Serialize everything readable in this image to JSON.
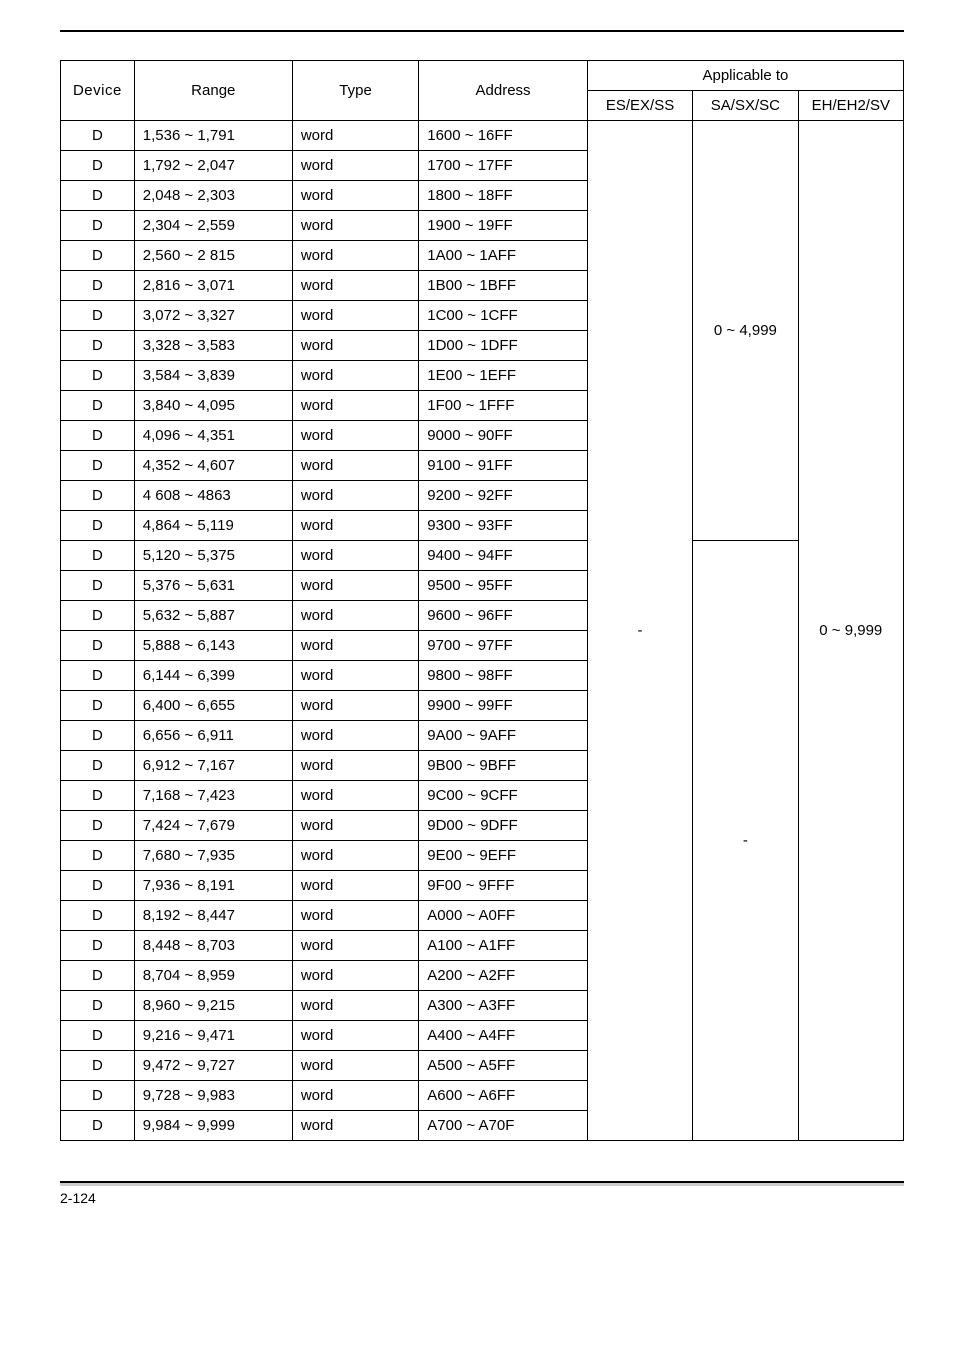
{
  "headers": {
    "device": "Device",
    "range": "Range",
    "type": "Type",
    "address": "Address",
    "applicable_to": "Applicable to",
    "es": "ES/EX/SS",
    "sa": "SA/SX/SC",
    "eh": "EH/EH2/SV"
  },
  "merged": {
    "es": "-",
    "sa1": "0 ~ 4,999",
    "sa2": "-",
    "eh": "0 ~ 9,999"
  },
  "rows": [
    {
      "device": "D",
      "range": "1,536 ~ 1,791",
      "type": "word",
      "address": "1600 ~ 16FF"
    },
    {
      "device": "D",
      "range": "1,792 ~ 2,047",
      "type": "word",
      "address": "1700 ~ 17FF"
    },
    {
      "device": "D",
      "range": "2,048 ~ 2,303",
      "type": "word",
      "address": "1800 ~ 18FF"
    },
    {
      "device": "D",
      "range": "2,304 ~ 2,559",
      "type": "word",
      "address": "1900 ~ 19FF"
    },
    {
      "device": "D",
      "range": "2,560 ~ 2 815",
      "type": "word",
      "address": "1A00 ~ 1AFF"
    },
    {
      "device": "D",
      "range": "2,816 ~ 3,071",
      "type": "word",
      "address": "1B00 ~ 1BFF"
    },
    {
      "device": "D",
      "range": "3,072 ~ 3,327",
      "type": "word",
      "address": "1C00 ~ 1CFF"
    },
    {
      "device": "D",
      "range": "3,328 ~ 3,583",
      "type": "word",
      "address": "1D00 ~ 1DFF"
    },
    {
      "device": "D",
      "range": "3,584 ~ 3,839",
      "type": "word",
      "address": "1E00 ~ 1EFF"
    },
    {
      "device": "D",
      "range": "3,840 ~ 4,095",
      "type": "word",
      "address": "1F00 ~ 1FFF"
    },
    {
      "device": "D",
      "range": "4,096 ~ 4,351",
      "type": "word",
      "address": "9000 ~ 90FF"
    },
    {
      "device": "D",
      "range": "4,352 ~ 4,607",
      "type": "word",
      "address": "9100 ~ 91FF"
    },
    {
      "device": "D",
      "range": "4 608 ~ 4863",
      "type": "word",
      "address": "9200 ~ 92FF"
    },
    {
      "device": "D",
      "range": "4,864 ~ 5,119",
      "type": "word",
      "address": "9300 ~ 93FF"
    },
    {
      "device": "D",
      "range": "5,120 ~ 5,375",
      "type": "word",
      "address": "9400 ~ 94FF"
    },
    {
      "device": "D",
      "range": "5,376 ~ 5,631",
      "type": "word",
      "address": "9500 ~ 95FF"
    },
    {
      "device": "D",
      "range": "5,632 ~ 5,887",
      "type": "word",
      "address": "9600 ~ 96FF"
    },
    {
      "device": "D",
      "range": "5,888 ~ 6,143",
      "type": "word",
      "address": "9700 ~ 97FF"
    },
    {
      "device": "D",
      "range": "6,144 ~ 6,399",
      "type": "word",
      "address": "9800 ~ 98FF"
    },
    {
      "device": "D",
      "range": "6,400 ~ 6,655",
      "type": "word",
      "address": "9900 ~ 99FF"
    },
    {
      "device": "D",
      "range": "6,656 ~ 6,911",
      "type": "word",
      "address": "9A00 ~ 9AFF"
    },
    {
      "device": "D",
      "range": "6,912 ~ 7,167",
      "type": "word",
      "address": "9B00 ~ 9BFF"
    },
    {
      "device": "D",
      "range": "7,168 ~ 7,423",
      "type": "word",
      "address": "9C00 ~ 9CFF"
    },
    {
      "device": "D",
      "range": "7,424 ~ 7,679",
      "type": "word",
      "address": "9D00 ~ 9DFF"
    },
    {
      "device": "D",
      "range": "7,680 ~ 7,935",
      "type": "word",
      "address": "9E00 ~ 9EFF"
    },
    {
      "device": "D",
      "range": "7,936 ~ 8,191",
      "type": "word",
      "address": "9F00 ~ 9FFF"
    },
    {
      "device": "D",
      "range": "8,192 ~ 8,447",
      "type": "word",
      "address": "A000 ~ A0FF"
    },
    {
      "device": "D",
      "range": "8,448 ~ 8,703",
      "type": "word",
      "address": "A100 ~ A1FF"
    },
    {
      "device": "D",
      "range": "8,704 ~ 8,959",
      "type": "word",
      "address": "A200 ~ A2FF"
    },
    {
      "device": "D",
      "range": "8,960 ~ 9,215",
      "type": "word",
      "address": "A300 ~ A3FF"
    },
    {
      "device": "D",
      "range": "9,216 ~ 9,471",
      "type": "word",
      "address": "A400 ~ A4FF"
    },
    {
      "device": "D",
      "range": "9,472 ~ 9,727",
      "type": "word",
      "address": "A500 ~ A5FF"
    },
    {
      "device": "D",
      "range": "9,728 ~ 9,983",
      "type": "word",
      "address": "A600 ~ A6FF"
    },
    {
      "device": "D",
      "range": "9,984 ~ 9,999",
      "type": "word",
      "address": "A700 ~ A70F"
    }
  ],
  "page_number": "2-124"
}
